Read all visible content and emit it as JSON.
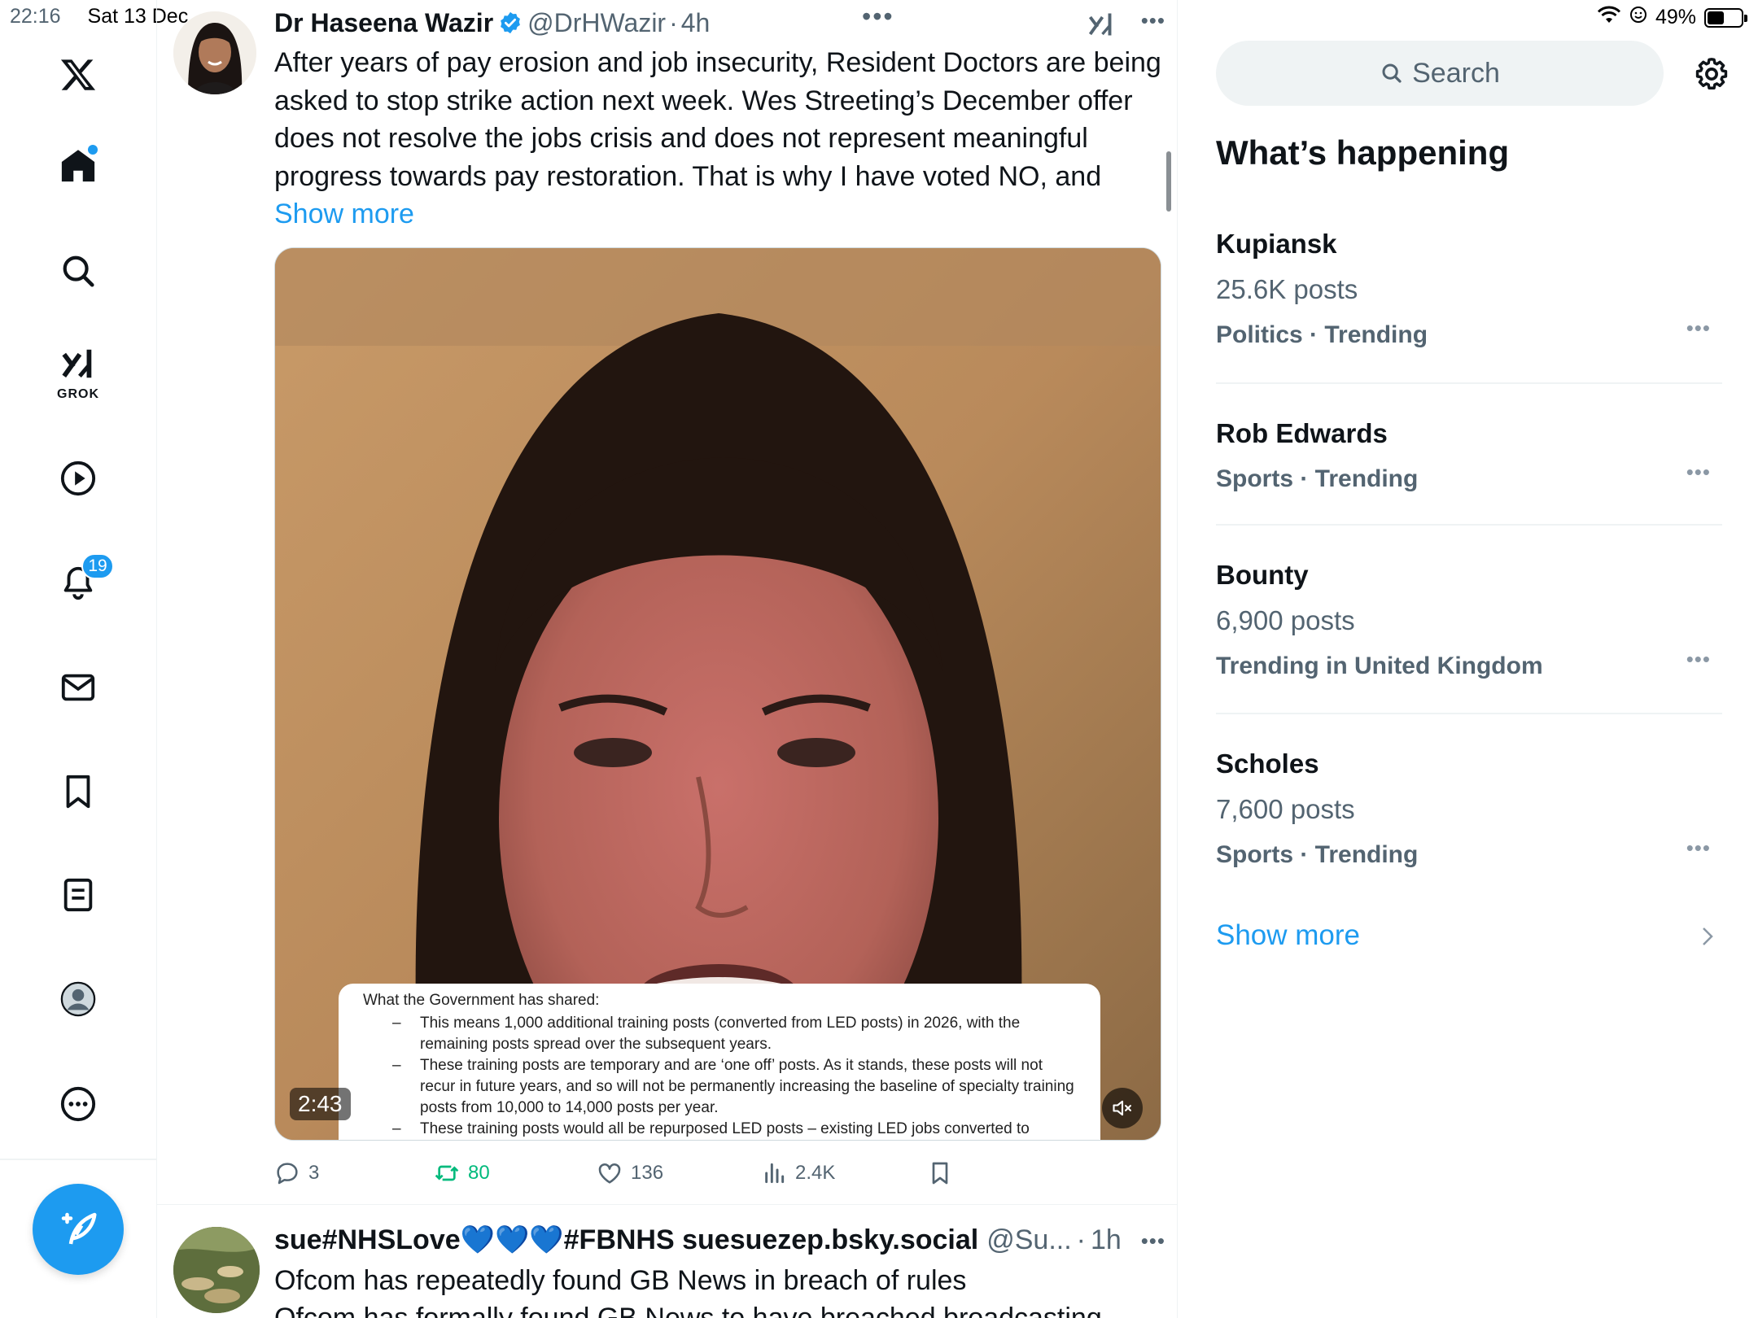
{
  "status_bar": {
    "time": "22:16",
    "date": "Sat 13 Dec",
    "battery": "49%",
    "battery_level": 0.49
  },
  "nav": {
    "logo": "x-logo-icon",
    "items": [
      {
        "name": "home",
        "icon": "home-icon"
      },
      {
        "name": "explore",
        "icon": "search-icon"
      },
      {
        "name": "grok",
        "icon": "grok-icon",
        "label": "GROK"
      },
      {
        "name": "video",
        "icon": "play-icon"
      },
      {
        "name": "notifications",
        "icon": "bell-icon",
        "badge": "19"
      },
      {
        "name": "messages",
        "icon": "mail-icon"
      },
      {
        "name": "bookmarks",
        "icon": "bookmark-icon"
      },
      {
        "name": "lists",
        "icon": "list-icon"
      },
      {
        "name": "profile",
        "icon": "profile-icon"
      },
      {
        "name": "more",
        "icon": "more-circle-icon"
      }
    ],
    "compose_icon": "compose-icon"
  },
  "tweet1": {
    "author_name": "Dr Haseena Wazir",
    "handle": "@DrHWazir",
    "separator": "·",
    "time": "4h",
    "text": "After years of pay erosion and job insecurity, Resident Doctors are being asked to stop strike action next week. Wes Streeting’s December offer does not resolve the jobs crisis and does not represent meaningful progress towards pay restoration. That is why I have voted NO, and ",
    "show_more": "Show more",
    "video": {
      "duration": "2:43",
      "overlay_heading": "What the Government has shared:",
      "overlay_points": [
        "This means 1,000 additional training posts (converted from LED posts) in 2026, with the remaining posts spread over the subsequent years.",
        "These training posts are temporary and are ‘one off’ posts. As it stands, these posts will not recur in future years, and so will not be permanently increasing the baseline of specialty training posts from 10,000 to 14,000 posts per year.",
        "These training posts would all be repurposed LED posts – existing LED jobs converted to"
      ]
    },
    "actions": {
      "replies": "3",
      "reposts": "80",
      "likes": "136",
      "views": "2.4K"
    }
  },
  "tweet2": {
    "author_name": "sue#NHSLove💙💙💙#FBNHS suesuezep.bsky.social",
    "handle": "@Su...",
    "separator": "·",
    "time": "1h",
    "text_line1": "Ofcom has repeatedly found GB News in breach of rules",
    "text_line2": "Ofcom has formally found GB News to have breached broadcasting"
  },
  "sidebar": {
    "search_placeholder": "Search",
    "section_title": "What’s happening",
    "trends": [
      {
        "title": "Kupiansk",
        "posts": "25.6K posts",
        "category": "Politics · Trending"
      },
      {
        "title": "Rob Edwards",
        "posts": "",
        "category": "Sports · Trending"
      },
      {
        "title": "Bounty",
        "posts": "6,900 posts",
        "category": "Trending in United Kingdom"
      },
      {
        "title": "Scholes",
        "posts": "7,600 posts",
        "category": "Sports · Trending"
      }
    ],
    "show_more": "Show more"
  },
  "colors": {
    "accent": "#1d9bf0",
    "repost_green": "#00ba7c",
    "secondary_text": "#536471",
    "primary_text": "#0f1419"
  }
}
